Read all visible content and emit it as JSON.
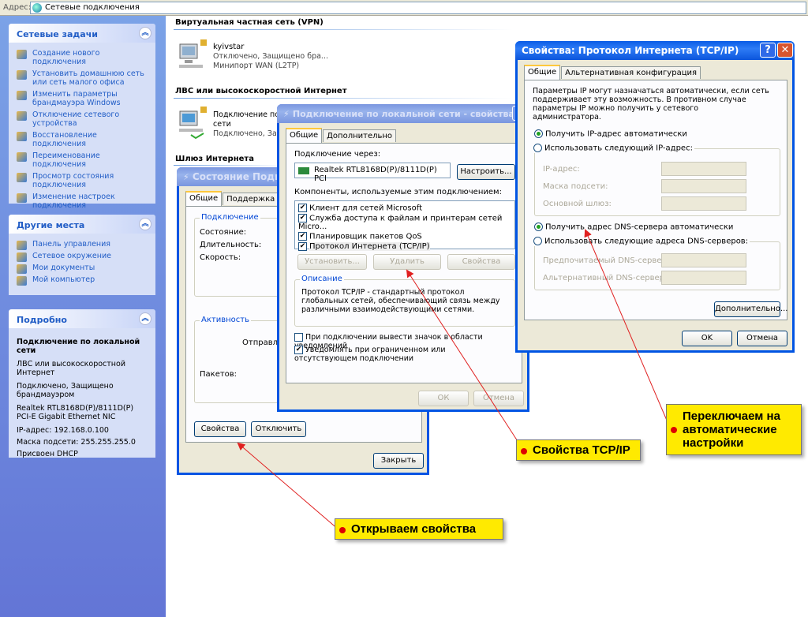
{
  "address": {
    "label": "Адрес:",
    "value": "Сетевые подключения"
  },
  "tasks": {
    "title": "Сетевые задачи",
    "items": [
      "Создание нового подключения",
      "Установить домашнюю сеть или сеть малого офиса",
      "Изменить параметры брандмауэра Windows",
      "Отключение сетевого устройства",
      "Восстановление подключения",
      "Переименование подключения",
      "Просмотр состояния подключения",
      "Изменение настроек подключения"
    ]
  },
  "places": {
    "title": "Другие места",
    "items": [
      "Панель управления",
      "Сетевое окружение",
      "Мои документы",
      "Мой компьютер"
    ]
  },
  "details": {
    "title": "Подробно",
    "name": "Подключение по локальной сети",
    "lines": [
      "ЛВС или высокоскоростной Интернет",
      "Подключено, Защищено брандмауэром",
      "Realtek RTL8168D(P)/8111D(P) PCI-E Gigabit Ethernet NIC",
      "IP-адрес: 192.168.0.100",
      "Маска подсети: 255.255.255.0",
      "Присвоен DHCP"
    ]
  },
  "main": {
    "vpn_header": "Виртуальная частная сеть (VPN)",
    "vpn": {
      "name": "kyivstar",
      "status": "Отключено, Защищено бра...",
      "device": "Минипорт WAN (L2TP)"
    },
    "lan_header": "ЛВС или высокоскоростной Интернет",
    "lan": {
      "name1": "Подключение по",
      "name2": "сети",
      "status": "Подключено, Защ"
    },
    "gateway_header": "Шлюз Интернета"
  },
  "status_win": {
    "title": "Состояние Подкл",
    "tabs": [
      "Общие",
      "Поддержка"
    ],
    "conn_legend": "Подключение",
    "rows": [
      "Состояние:",
      "Длительность:",
      "Скорость:"
    ],
    "activity_legend": "Активность",
    "sent": "Отправлен",
    "packets": "Пакетов:",
    "btn_props": "Свойства",
    "btn_disable": "Отключить",
    "btn_close": "Закрыть"
  },
  "props_win": {
    "title": "Подключение по локальной сети - свойства",
    "tabs": [
      "Общие",
      "Дополнительно"
    ],
    "connect_via": "Подключение через:",
    "adapter": "Realtek RTL8168D(P)/8111D(P) PCI",
    "btn_configure": "Настроить...",
    "components_label": "Компоненты, используемые этим подключением:",
    "components": [
      "Клиент для сетей Microsoft",
      "Служба доступа к файлам и принтерам сетей Micro...",
      "Планировщик пакетов QoS",
      "Протокол Интернета (TCP/IP)"
    ],
    "btn_install": "Установить...",
    "btn_remove": "Удалить",
    "btn_props": "Свойства",
    "desc_legend": "Описание",
    "desc": "Протокол TCP/IP - стандартный протокол глобальных сетей, обеспечивающий связь между различными взаимодействующими сетями.",
    "chk1": "При подключении вывести значок в области уведомлений",
    "chk2": "Уведомлять при ограниченном или отсутствующем подключении",
    "btn_ok": "ОК",
    "btn_cancel": "Отмена"
  },
  "tcp_win": {
    "title": "Свойства: Протокол Интернета (TCP/IP)",
    "tabs": [
      "Общие",
      "Альтернативная конфигурация"
    ],
    "intro": "Параметры IP могут назначаться автоматически, если сеть поддерживает эту возможность. В противном случае параметры IP можно получить у сетевого администратора.",
    "radio_ip_auto": "Получить IP-адрес автоматически",
    "radio_ip_manual": "Использовать следующий IP-адрес:",
    "ip": "IP-адрес:",
    "mask": "Маска подсети:",
    "gw": "Основной шлюз:",
    "radio_dns_auto": "Получить адрес DNS-сервера автоматически",
    "radio_dns_manual": "Использовать следующие адреса DNS-серверов:",
    "dns1": "Предпочитаемый DNS-сервер:",
    "dns2": "Альтернативный DNS-сервер:",
    "btn_adv": "Дополнительно...",
    "btn_ok": "OK",
    "btn_cancel": "Отмена"
  },
  "callouts": {
    "auto1": "Переключаем на",
    "auto2": "автоматические",
    "auto3": "настройки",
    "tcp": "Свойства TCP/IP",
    "open": "Открываем свойства"
  },
  "colors": {
    "callout": "#ffea00",
    "arrow": "#e02020",
    "titlebar": "#0a5ce6"
  }
}
